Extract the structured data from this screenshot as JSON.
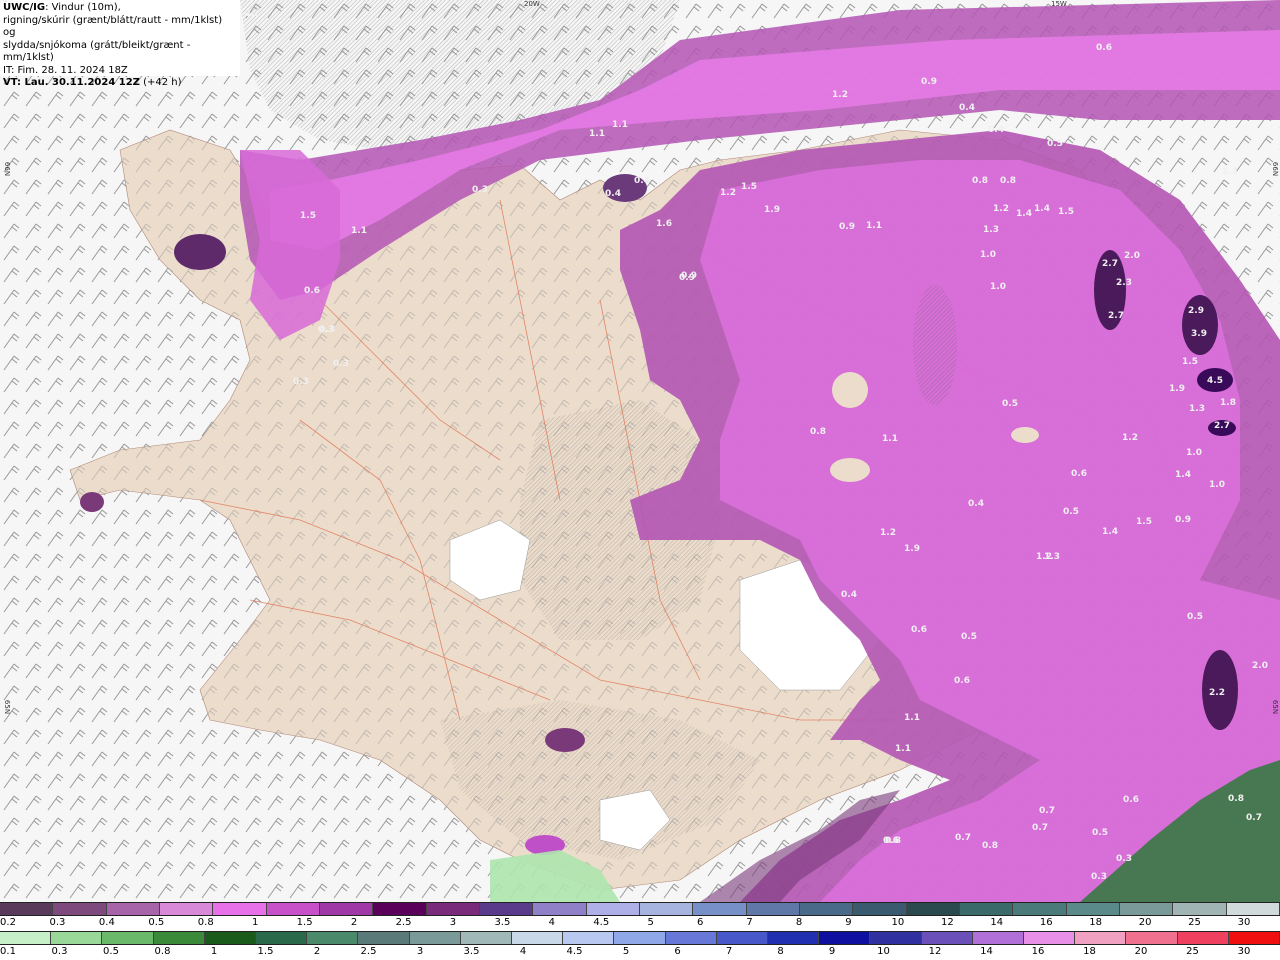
{
  "header": {
    "model": "UWC/IG",
    "description_line1": ": Vindur (10m),",
    "description_line2": "rigning/skúrir (grænt/blátt/rautt - mm/1klst) og",
    "description_line3": "slydda/snjókoma (grátt/bleikt/grænt - mm/1klst)",
    "init_time": "IT: Fim. 28. 11. 2024 18Z",
    "valid_time_label": "VT: Lau. 30.11.2024 12Z",
    "valid_offset": " (+42 h)"
  },
  "grid_labels": {
    "lon_20w": "20W",
    "lon_15w": "15W",
    "lat_66n_left": "66N",
    "lat_66n_right": "66N",
    "lat_65n_left": "65N",
    "lat_65n_right": "65N"
  },
  "precip_values": [
    "0.2",
    "0.6",
    "0.9",
    "0.4",
    "1.2",
    "0.4",
    "0.5",
    "1.1",
    "1.1",
    "0.3",
    "1.5",
    "1.1",
    "0.4",
    "0.6",
    "0.3",
    "0.3",
    "0.3",
    "0.4",
    "0.8",
    "1.2",
    "1.5",
    "1.9",
    "1.6",
    "1.3",
    "0.9",
    "1.1",
    "0.9",
    "0.8",
    "1.2",
    "1.4",
    "1.4",
    "1.5",
    "1.3",
    "1.0",
    "1.0",
    "2.7",
    "2.0",
    "2.3",
    "2.7",
    "2.9",
    "3.9",
    "1.5",
    "4.5",
    "1.9",
    "1.3",
    "1.8",
    "2.7",
    "1.0",
    "1.4",
    "1.0",
    "0.9",
    "1.5",
    "1.2",
    "0.5",
    "1.4",
    "1.3",
    "1.2",
    "1.9",
    "1.2",
    "0.4",
    "0.6",
    "0.5",
    "1.1",
    "0.3",
    "0.8",
    "0.6",
    "2.2",
    "2.0",
    "0.7",
    "0.6",
    "0.5",
    "0.3",
    "0.3",
    "0.8",
    "0.7",
    "0.7",
    "0.7",
    "0.8",
    "0.6",
    "0.6",
    "0.8",
    "0.5",
    "0.4",
    "1.1",
    "1.1",
    "0.9",
    "0.5",
    "0.4",
    "1.1"
  ],
  "legend": {
    "row1_colors": [
      "#5a3a5a",
      "#7e4a7e",
      "#a864a8",
      "#d88ad8",
      "#e870e8",
      "#c850c8",
      "#a038a8",
      "#5a005a",
      "#7a2a7a",
      "#5a3a8a",
      "#9080c8",
      "#b0b0e8",
      "#a8b4e0",
      "#7890c8",
      "#6078a8",
      "#4a6a8a",
      "#3a5a70",
      "#2a4a50",
      "#3a6a6a",
      "#4a7a7a",
      "#5a8a8a",
      "#7a9a9a",
      "#a0b4b4",
      "#d0dada"
    ],
    "row1_labels": [
      "0.2",
      "0.3",
      "0.4",
      "0.5",
      "0.8",
      "1",
      "1.5",
      "2",
      "2.5",
      "3",
      "3.5",
      "4",
      "4.5",
      "5",
      "6",
      "7",
      "8",
      "9",
      "10",
      "12",
      "14",
      "16",
      "18",
      "20",
      "25",
      "30"
    ],
    "row2_colors": [
      "#c8f0c8",
      "#9ad89a",
      "#6ab86a",
      "#3a8a3a",
      "#1a5a1a",
      "#2a6a4a",
      "#4a8a6a",
      "#5a7a7a",
      "#7a9a9a",
      "#a0b8b8",
      "#c8d8e8",
      "#b8c8f0",
      "#90a8e8",
      "#6878d8",
      "#4858c8",
      "#2030b0",
      "#1010a0",
      "#3030a0",
      "#6a50b8",
      "#b070d8",
      "#e890e8",
      "#f0a0c0",
      "#f07090",
      "#f04060",
      "#f01010"
    ],
    "row2_labels": [
      "0.1",
      "0.3",
      "0.5",
      "0.8",
      "1",
      "1.5",
      "2",
      "2.5",
      "3",
      "3.5",
      "4",
      "4.5",
      "5",
      "6",
      "7",
      "8",
      "9",
      "10",
      "12",
      "14",
      "16",
      "18",
      "20",
      "25",
      "30"
    ]
  }
}
